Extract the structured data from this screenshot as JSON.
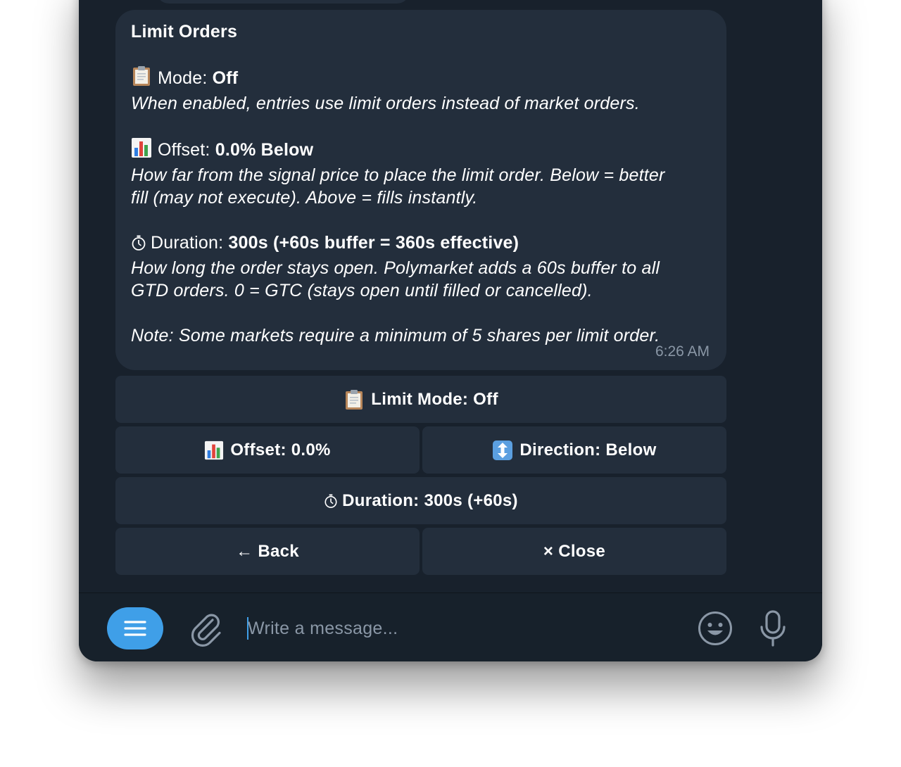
{
  "message": {
    "title": "Limit Orders",
    "mode": {
      "label": "Mode: ",
      "value": "Off",
      "description": "When enabled, entries use limit orders instead of market orders."
    },
    "offset": {
      "label": "Offset: ",
      "value": "0.0% Below",
      "description_line1": "How far from the signal price to place the limit order. Below = better",
      "description_line2": "fill (may not execute). Above = fills instantly."
    },
    "duration": {
      "label": "Duration: ",
      "value": "300s (+60s buffer = 360s effective)",
      "description_line1": "How long the order stays open. Polymarket adds a 60s buffer to all",
      "description_line2": "GTD orders. 0 = GTC (stays open until filled or cancelled)."
    },
    "note": "Note: Some markets require a minimum of 5 shares per limit order.",
    "time": "6:26 AM"
  },
  "buttons": {
    "limit_mode": "Limit Mode: Off",
    "offset": "Offset: 0.0%",
    "direction": "Direction: Below",
    "duration": "Duration: 300s (+60s)",
    "back": "← Back",
    "close": "× Close"
  },
  "composer": {
    "placeholder": "Write a message..."
  },
  "icons": {
    "mode": "clipboard-icon",
    "offset": "bar-chart-icon",
    "duration": "stopwatch-icon",
    "direction": "up-down-arrow-icon",
    "menu": "menu-icon",
    "attach": "paperclip-icon",
    "emoji": "smiley-icon",
    "mic": "microphone-icon"
  },
  "colors": {
    "background": "#18212c",
    "bubble": "#232e3c",
    "accent": "#3f9fe8",
    "muted_text": "#8a97a6"
  }
}
